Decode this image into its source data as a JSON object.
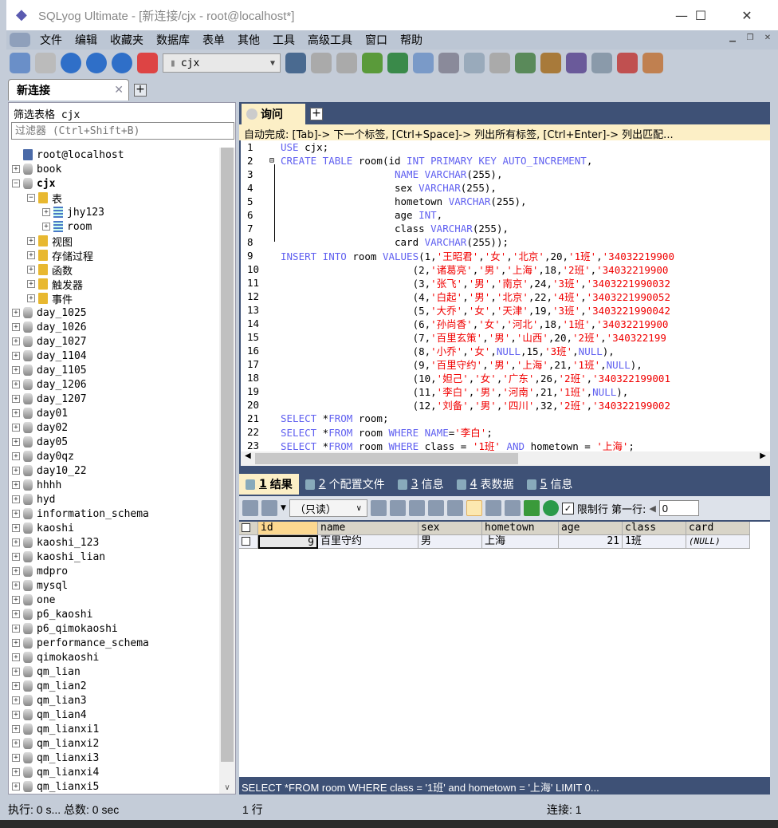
{
  "window": {
    "title": "SQLyog Ultimate - [新连接/cjx - root@localhost*]",
    "minimize": "—",
    "maximize": "☐",
    "close": "✕"
  },
  "menu": [
    "文件",
    "编辑",
    "收藏夹",
    "数据库",
    "表单",
    "其他",
    "工具",
    "高级工具",
    "窗口",
    "帮助"
  ],
  "toolbar": {
    "database": "cjx"
  },
  "connection_tab": {
    "label": "新连接",
    "close": "✕",
    "add": "+"
  },
  "left": {
    "header": "筛选表格 cjx",
    "filter_placeholder": "过滤器 (Ctrl+Shift+B)",
    "tree": [
      {
        "label": "root@localhost",
        "level": 0,
        "icon": "server",
        "exp": ""
      },
      {
        "label": "book",
        "level": 0,
        "icon": "db",
        "exp": "+"
      },
      {
        "label": "cjx",
        "level": 0,
        "icon": "db",
        "exp": "−",
        "bold": true
      },
      {
        "label": "表",
        "level": 1,
        "icon": "folder",
        "exp": "−"
      },
      {
        "label": "jhy123",
        "level": 2,
        "icon": "table",
        "exp": "+"
      },
      {
        "label": "room",
        "level": 2,
        "icon": "table",
        "exp": "+"
      },
      {
        "label": "视图",
        "level": 1,
        "icon": "folder",
        "exp": "+"
      },
      {
        "label": "存储过程",
        "level": 1,
        "icon": "folder",
        "exp": "+"
      },
      {
        "label": "函数",
        "level": 1,
        "icon": "folder",
        "exp": "+"
      },
      {
        "label": "触发器",
        "level": 1,
        "icon": "folder",
        "exp": "+"
      },
      {
        "label": "事件",
        "level": 1,
        "icon": "folder",
        "exp": "+"
      },
      {
        "label": "day_1025",
        "level": 0,
        "icon": "db",
        "exp": "+"
      },
      {
        "label": "day_1026",
        "level": 0,
        "icon": "db",
        "exp": "+"
      },
      {
        "label": "day_1027",
        "level": 0,
        "icon": "db",
        "exp": "+"
      },
      {
        "label": "day_1104",
        "level": 0,
        "icon": "db",
        "exp": "+"
      },
      {
        "label": "day_1105",
        "level": 0,
        "icon": "db",
        "exp": "+"
      },
      {
        "label": "day_1206",
        "level": 0,
        "icon": "db",
        "exp": "+"
      },
      {
        "label": "day_1207",
        "level": 0,
        "icon": "db",
        "exp": "+"
      },
      {
        "label": "day01",
        "level": 0,
        "icon": "db",
        "exp": "+"
      },
      {
        "label": "day02",
        "level": 0,
        "icon": "db",
        "exp": "+"
      },
      {
        "label": "day05",
        "level": 0,
        "icon": "db",
        "exp": "+"
      },
      {
        "label": "day0qz",
        "level": 0,
        "icon": "db",
        "exp": "+"
      },
      {
        "label": "day10_22",
        "level": 0,
        "icon": "db",
        "exp": "+"
      },
      {
        "label": "hhhh",
        "level": 0,
        "icon": "db",
        "exp": "+"
      },
      {
        "label": "hyd",
        "level": 0,
        "icon": "db",
        "exp": "+"
      },
      {
        "label": "information_schema",
        "level": 0,
        "icon": "db",
        "exp": "+"
      },
      {
        "label": "kaoshi",
        "level": 0,
        "icon": "db",
        "exp": "+"
      },
      {
        "label": "kaoshi_123",
        "level": 0,
        "icon": "db",
        "exp": "+"
      },
      {
        "label": "kaoshi_lian",
        "level": 0,
        "icon": "db",
        "exp": "+"
      },
      {
        "label": "mdpro",
        "level": 0,
        "icon": "db",
        "exp": "+"
      },
      {
        "label": "mysql",
        "level": 0,
        "icon": "db",
        "exp": "+"
      },
      {
        "label": "one",
        "level": 0,
        "icon": "db",
        "exp": "+"
      },
      {
        "label": "p6_kaoshi",
        "level": 0,
        "icon": "db",
        "exp": "+"
      },
      {
        "label": "p6_qimokaoshi",
        "level": 0,
        "icon": "db",
        "exp": "+"
      },
      {
        "label": "performance_schema",
        "level": 0,
        "icon": "db",
        "exp": "+"
      },
      {
        "label": "qimokaoshi",
        "level": 0,
        "icon": "db",
        "exp": "+"
      },
      {
        "label": "qm_lian",
        "level": 0,
        "icon": "db",
        "exp": "+"
      },
      {
        "label": "qm_lian2",
        "level": 0,
        "icon": "db",
        "exp": "+"
      },
      {
        "label": "qm_lian3",
        "level": 0,
        "icon": "db",
        "exp": "+"
      },
      {
        "label": "qm_lian4",
        "level": 0,
        "icon": "db",
        "exp": "+"
      },
      {
        "label": "qm_lianxi1",
        "level": 0,
        "icon": "db",
        "exp": "+"
      },
      {
        "label": "qm_lianxi2",
        "level": 0,
        "icon": "db",
        "exp": "+"
      },
      {
        "label": "qm_lianxi3",
        "level": 0,
        "icon": "db",
        "exp": "+"
      },
      {
        "label": "qm_lianxi4",
        "level": 0,
        "icon": "db",
        "exp": "+"
      },
      {
        "label": "qm_lianxi5",
        "level": 0,
        "icon": "db",
        "exp": "+"
      }
    ]
  },
  "query": {
    "tab": "询问",
    "add": "+",
    "autocomplete": "自动完成: [Tab]-> 下一个标签, [Ctrl+Space]-> 列出所有标签, [Ctrl+Enter]-> 列出匹配...",
    "lines": [
      [
        [
          "k",
          "USE"
        ],
        [
          "p",
          " cjx;"
        ]
      ],
      [
        [
          "k",
          "CREATE TABLE"
        ],
        [
          "p",
          " room(id "
        ],
        [
          "k",
          "INT PRIMARY KEY AUTO_INCREMENT"
        ],
        [
          "p",
          ","
        ]
      ],
      [
        [
          "p",
          "                   "
        ],
        [
          "k",
          "NAME VARCHAR"
        ],
        [
          "p",
          "(255),"
        ]
      ],
      [
        [
          "p",
          "                   sex "
        ],
        [
          "k",
          "VARCHAR"
        ],
        [
          "p",
          "(255),"
        ]
      ],
      [
        [
          "p",
          "                   hometown "
        ],
        [
          "k",
          "VARCHAR"
        ],
        [
          "p",
          "(255),"
        ]
      ],
      [
        [
          "p",
          "                   age "
        ],
        [
          "k",
          "INT"
        ],
        [
          "p",
          ","
        ]
      ],
      [
        [
          "p",
          "                   class "
        ],
        [
          "k",
          "VARCHAR"
        ],
        [
          "p",
          "(255),"
        ]
      ],
      [
        [
          "p",
          "                   card "
        ],
        [
          "k",
          "VARCHAR"
        ],
        [
          "p",
          "(255));"
        ]
      ],
      [
        [
          "k",
          "INSERT INTO"
        ],
        [
          "p",
          " room "
        ],
        [
          "k",
          "VALUES"
        ],
        [
          "p",
          "(1,"
        ],
        [
          "s",
          "'王昭君'"
        ],
        [
          "p",
          ","
        ],
        [
          "s",
          "'女'"
        ],
        [
          "p",
          ","
        ],
        [
          "s",
          "'北京'"
        ],
        [
          "p",
          ",20,"
        ],
        [
          "s",
          "'1班'"
        ],
        [
          "p",
          ","
        ],
        [
          "s",
          "'34032219900"
        ]
      ],
      [
        [
          "p",
          "                      (2,"
        ],
        [
          "s",
          "'诸葛亮'"
        ],
        [
          "p",
          ","
        ],
        [
          "s",
          "'男'"
        ],
        [
          "p",
          ","
        ],
        [
          "s",
          "'上海'"
        ],
        [
          "p",
          ",18,"
        ],
        [
          "s",
          "'2班'"
        ],
        [
          "p",
          ","
        ],
        [
          "s",
          "'34032219900"
        ]
      ],
      [
        [
          "p",
          "                      (3,"
        ],
        [
          "s",
          "'张飞'"
        ],
        [
          "p",
          ","
        ],
        [
          "s",
          "'男'"
        ],
        [
          "p",
          ","
        ],
        [
          "s",
          "'南京'"
        ],
        [
          "p",
          ",24,"
        ],
        [
          "s",
          "'3班'"
        ],
        [
          "p",
          ","
        ],
        [
          "s",
          "'3403221990032"
        ]
      ],
      [
        [
          "p",
          "                      (4,"
        ],
        [
          "s",
          "'白起'"
        ],
        [
          "p",
          ","
        ],
        [
          "s",
          "'男'"
        ],
        [
          "p",
          ","
        ],
        [
          "s",
          "'北京'"
        ],
        [
          "p",
          ",22,"
        ],
        [
          "s",
          "'4班'"
        ],
        [
          "p",
          ","
        ],
        [
          "s",
          "'3403221990052"
        ]
      ],
      [
        [
          "p",
          "                      (5,"
        ],
        [
          "s",
          "'大乔'"
        ],
        [
          "p",
          ","
        ],
        [
          "s",
          "'女'"
        ],
        [
          "p",
          ","
        ],
        [
          "s",
          "'天津'"
        ],
        [
          "p",
          ",19,"
        ],
        [
          "s",
          "'3班'"
        ],
        [
          "p",
          ","
        ],
        [
          "s",
          "'3403221990042"
        ]
      ],
      [
        [
          "p",
          "                      (6,"
        ],
        [
          "s",
          "'孙尚香'"
        ],
        [
          "p",
          ","
        ],
        [
          "s",
          "'女'"
        ],
        [
          "p",
          ","
        ],
        [
          "s",
          "'河北'"
        ],
        [
          "p",
          ",18,"
        ],
        [
          "s",
          "'1班'"
        ],
        [
          "p",
          ","
        ],
        [
          "s",
          "'34032219900"
        ]
      ],
      [
        [
          "p",
          "                      (7,"
        ],
        [
          "s",
          "'百里玄策'"
        ],
        [
          "p",
          ","
        ],
        [
          "s",
          "'男'"
        ],
        [
          "p",
          ","
        ],
        [
          "s",
          "'山西'"
        ],
        [
          "p",
          ",20,"
        ],
        [
          "s",
          "'2班'"
        ],
        [
          "p",
          ","
        ],
        [
          "s",
          "'340322199"
        ]
      ],
      [
        [
          "p",
          "                      (8,"
        ],
        [
          "s",
          "'小乔'"
        ],
        [
          "p",
          ","
        ],
        [
          "s",
          "'女'"
        ],
        [
          "p",
          ","
        ],
        [
          "k",
          "NULL"
        ],
        [
          "p",
          ",15,"
        ],
        [
          "s",
          "'3班'"
        ],
        [
          "p",
          ","
        ],
        [
          "k",
          "NULL"
        ],
        [
          "p",
          "),"
        ]
      ],
      [
        [
          "p",
          "                      (9,"
        ],
        [
          "s",
          "'百里守约'"
        ],
        [
          "p",
          ","
        ],
        [
          "s",
          "'男'"
        ],
        [
          "p",
          ","
        ],
        [
          "s",
          "'上海'"
        ],
        [
          "p",
          ",21,"
        ],
        [
          "s",
          "'1班'"
        ],
        [
          "p",
          ","
        ],
        [
          "k",
          "NULL"
        ],
        [
          "p",
          "),"
        ]
      ],
      [
        [
          "p",
          "                      (10,"
        ],
        [
          "s",
          "'妲己'"
        ],
        [
          "p",
          ","
        ],
        [
          "s",
          "'女'"
        ],
        [
          "p",
          ","
        ],
        [
          "s",
          "'广东'"
        ],
        [
          "p",
          ",26,"
        ],
        [
          "s",
          "'2班'"
        ],
        [
          "p",
          ","
        ],
        [
          "s",
          "'340322199001"
        ]
      ],
      [
        [
          "p",
          "                      (11,"
        ],
        [
          "s",
          "'李白'"
        ],
        [
          "p",
          ","
        ],
        [
          "s",
          "'男'"
        ],
        [
          "p",
          ","
        ],
        [
          "s",
          "'河南'"
        ],
        [
          "p",
          ",21,"
        ],
        [
          "s",
          "'1班'"
        ],
        [
          "p",
          ","
        ],
        [
          "k",
          "NULL"
        ],
        [
          "p",
          "),"
        ]
      ],
      [
        [
          "p",
          "                      (12,"
        ],
        [
          "s",
          "'刘备'"
        ],
        [
          "p",
          ","
        ],
        [
          "s",
          "'男'"
        ],
        [
          "p",
          ","
        ],
        [
          "s",
          "'四川'"
        ],
        [
          "p",
          ",32,"
        ],
        [
          "s",
          "'2班'"
        ],
        [
          "p",
          ","
        ],
        [
          "s",
          "'340322199002"
        ]
      ],
      [
        [
          "k",
          "SELECT"
        ],
        [
          "p",
          " *"
        ],
        [
          "k",
          "FROM"
        ],
        [
          "p",
          " room;"
        ]
      ],
      [
        [
          "k",
          "SELECT"
        ],
        [
          "p",
          " *"
        ],
        [
          "k",
          "FROM"
        ],
        [
          "p",
          " room "
        ],
        [
          "k",
          "WHERE NAME"
        ],
        [
          "p",
          "="
        ],
        [
          "s",
          "'李白'"
        ],
        [
          "p",
          ";"
        ]
      ],
      [
        [
          "k",
          "SELECT"
        ],
        [
          "p",
          " *"
        ],
        [
          "k",
          "FROM"
        ],
        [
          "p",
          " room "
        ],
        [
          "k",
          "WHERE"
        ],
        [
          "p",
          " class = "
        ],
        [
          "s",
          "'1班'"
        ],
        [
          "p",
          " "
        ],
        [
          "k",
          "AND"
        ],
        [
          "p",
          " hometown = "
        ],
        [
          "s",
          "'上海'"
        ],
        [
          "p",
          ";"
        ]
      ]
    ]
  },
  "results": {
    "tabs": [
      {
        "num": "1",
        "label": "结果",
        "active": true
      },
      {
        "num": "2",
        "label": "个配置文件"
      },
      {
        "num": "3",
        "label": "信息"
      },
      {
        "num": "4",
        "label": "表数据"
      },
      {
        "num": "5",
        "label": "信息"
      }
    ],
    "mode": "（只读）",
    "limit_label": "限制行",
    "limit_checked": true,
    "first_row_label": "第一行:",
    "first_row": "0",
    "columns": [
      "id",
      "name",
      "sex",
      "hometown",
      "age",
      "class",
      "card"
    ],
    "rows": [
      [
        "9",
        "百里守约",
        "男",
        "上海",
        "21",
        "1班",
        "(NULL)"
      ]
    ],
    "sql": "SELECT *FROM room WHERE class = '1班' and hometown = '上海' LIMIT 0..."
  },
  "status": {
    "exec": "执行: 0 s... 总数: 0 sec",
    "rows": "1 行",
    "conn": "连接: 1"
  }
}
